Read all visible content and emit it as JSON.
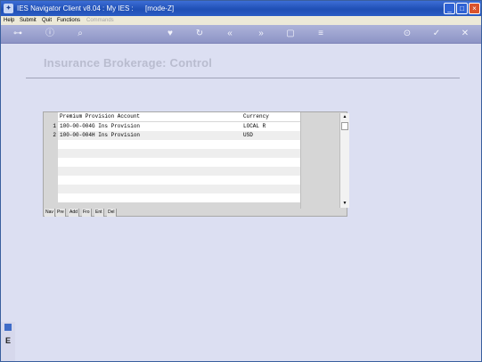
{
  "window": {
    "title": "IES Navigator Client v8.04 : My IES :      [mode-Z]",
    "controls": [
      "_",
      "□",
      "×"
    ]
  },
  "menu": {
    "items": [
      "Help",
      "Submit",
      "Quit",
      "Functions"
    ],
    "disabled_item": "Commands"
  },
  "toolbar": {
    "icons": [
      "key-icon",
      "info-icon",
      "search-icon",
      "heart-icon",
      "refresh-icon",
      "rewind-icon",
      "fast-forward-icon",
      "document-icon",
      "list-icon",
      "target-icon",
      "check-icon",
      "close-icon"
    ]
  },
  "page": {
    "heading": "Insurance Brokerage: Control"
  },
  "grid": {
    "columns": {
      "account": "Premium Provision Account",
      "currency": "Currency"
    },
    "rows": [
      {
        "num": "1",
        "account": "100-00-004G Ins Provision",
        "currency": "LOCAL R"
      },
      {
        "num": "2",
        "account": "100-00-004H Ins Provision",
        "currency": "USD"
      }
    ],
    "empty_rows": 7,
    "buttons": [
      "Nav",
      "Pre",
      "Add",
      "Fro",
      "Ent",
      "Del"
    ],
    "scroll": {
      "up": "▲",
      "down": "▼"
    }
  },
  "left_strip": {
    "label": "E"
  },
  "colors": {
    "title_bar": "#2a5cc4",
    "background": "#dcdff2",
    "toolbar": "#9aa0cf",
    "heading": "#b9bccf"
  }
}
